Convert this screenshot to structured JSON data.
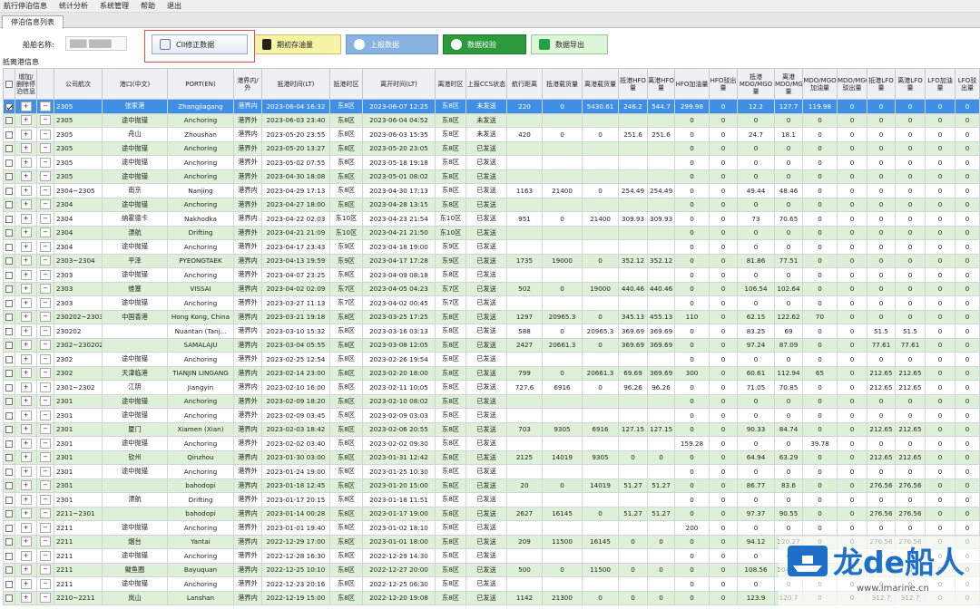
{
  "menu": [
    "航行停泊信息",
    "统计分析",
    "系统管理",
    "帮助",
    "退出"
  ],
  "tab": "停泊信息列表",
  "ship": {
    "label": "船舶名称:",
    "value": "███ ████"
  },
  "buttons": {
    "cii": "CII修正数据",
    "fuel": "期初存油量",
    "report": "上报数据",
    "validate": "数据校验",
    "export": "数据导出"
  },
  "section_title": "抵离港信息",
  "columns": [
    "",
    "增加/删除停泊信息",
    "",
    "公司航次",
    "港口(中文)",
    "PORT(EN)",
    "港界内/外",
    "抵港时间(LT)",
    "抵港时区",
    "离开时间(LT)",
    "离港时区",
    "上报CCS状态",
    "航行距离",
    "抵港载货量",
    "离港载货量",
    "抵港HFO量",
    "离港HFO量",
    "HFO加油量",
    "HFO驳出量",
    "抵港MDO/MGO量",
    "离港MDO/MGO量",
    "MDO/MGO加油量",
    "MDO/MGO驳出量",
    "抵港LFO量",
    "离港LFO量",
    "LFO加油量",
    "LFO驳出量"
  ],
  "rows": [
    [
      "1",
      "2305",
      "张家港",
      "Zhangjiagang",
      "港界内",
      "2023-06-04 16:32",
      "东8区",
      "2023-06-07 12:25",
      "东8区",
      "未发送",
      "220",
      "0",
      "5430.61",
      "246.2",
      "544.7",
      "299.98",
      "0",
      "12.2",
      "127.7",
      "119.98",
      "0",
      "0",
      "0",
      "0",
      "0"
    ],
    [
      "0",
      "2305",
      "途中抛锚",
      "Anchoring",
      "港界外",
      "2023-06-03 23:40",
      "东8区",
      "2023-06-04 04:52",
      "东8区",
      "未发送",
      "",
      "",
      "",
      "",
      "",
      "0",
      "0",
      "0",
      "0",
      "0",
      "0",
      "0",
      "0",
      "0",
      "0"
    ],
    [
      "0",
      "2305",
      "舟山",
      "Zhoushan",
      "港界内",
      "2023-05-20 23:55",
      "东8区",
      "2023-06-03 15:35",
      "东8区",
      "未发送",
      "420",
      "0",
      "0",
      "251.6",
      "251.6",
      "0",
      "0",
      "24.7",
      "18.1",
      "0",
      "0",
      "0",
      "0",
      "0",
      "0"
    ],
    [
      "0",
      "2305",
      "途中抛锚",
      "Anchoring",
      "港界外",
      "2023-05-20 13:27",
      "东8区",
      "2023-05-20 23:05",
      "东8区",
      "已发送",
      "",
      "",
      "",
      "",
      "",
      "0",
      "0",
      "0",
      "0",
      "0",
      "0",
      "0",
      "0",
      "0",
      "0"
    ],
    [
      "0",
      "2305",
      "途中抛锚",
      "Anchoring",
      "港界外",
      "2023-05-02 07:55",
      "东8区",
      "2023-05-18 19:18",
      "东8区",
      "已发送",
      "",
      "",
      "",
      "",
      "",
      "0",
      "0",
      "0",
      "0",
      "0",
      "0",
      "0",
      "0",
      "0",
      "0"
    ],
    [
      "0",
      "2305",
      "途中抛锚",
      "Anchoring",
      "港界外",
      "2023-04-30 18:08",
      "东8区",
      "2023-05-01 08:02",
      "东8区",
      "已发送",
      "",
      "",
      "",
      "",
      "",
      "0",
      "0",
      "0",
      "0",
      "0",
      "0",
      "0",
      "0",
      "0",
      "0"
    ],
    [
      "0",
      "2304~2305",
      "南京",
      "Nanjing",
      "港界内",
      "2023-04-29 17:13",
      "东8区",
      "2023-04-30 17:13",
      "东8区",
      "已发送",
      "1163",
      "21400",
      "0",
      "254.49",
      "254.49",
      "0",
      "0",
      "49.44",
      "48.46",
      "0",
      "0",
      "0",
      "0",
      "0",
      "0"
    ],
    [
      "0",
      "2304",
      "途中抛锚",
      "Anchoring",
      "港界外",
      "2023-04-27 18:00",
      "东8区",
      "2023-04-28 13:15",
      "东8区",
      "已发送",
      "",
      "",
      "",
      "",
      "",
      "0",
      "0",
      "0",
      "0",
      "0",
      "0",
      "0",
      "0",
      "0",
      "0"
    ],
    [
      "0",
      "2304",
      "纳霍德卡",
      "Nakhodka",
      "港界内",
      "2023-04-22 02:03",
      "东10区",
      "2023-04-23 21:54",
      "东10区",
      "已发送",
      "951",
      "0",
      "21400",
      "309.93",
      "309.93",
      "0",
      "0",
      "73",
      "70.65",
      "0",
      "0",
      "0",
      "0",
      "0",
      "0"
    ],
    [
      "0",
      "2304",
      "漂航",
      "Drifting",
      "港界外",
      "2023-04-21 21:09",
      "东10区",
      "2023-04-21 21:50",
      "东10区",
      "已发送",
      "",
      "",
      "",
      "",
      "",
      "0",
      "0",
      "0",
      "0",
      "0",
      "0",
      "0",
      "0",
      "0",
      "0"
    ],
    [
      "0",
      "2304",
      "途中抛锚",
      "Anchoring",
      "港界外",
      "2023-04-17 23:43",
      "东9区",
      "2023-04-18 19:00",
      "东9区",
      "已发送",
      "",
      "",
      "",
      "",
      "",
      "0",
      "0",
      "0",
      "0",
      "0",
      "0",
      "0",
      "0",
      "0",
      "0"
    ],
    [
      "0",
      "2303~2304",
      "平泽",
      "PYEONGTAEK",
      "港界内",
      "2023-04-13 19:59",
      "东9区",
      "2023-04-17 17:28",
      "东9区",
      "已发送",
      "1735",
      "19000",
      "0",
      "352.12",
      "352.12",
      "0",
      "0",
      "81.86",
      "77.51",
      "0",
      "0",
      "0",
      "0",
      "0",
      "0"
    ],
    [
      "0",
      "2303",
      "途中抛锚",
      "Anchoring",
      "港界外",
      "2023-04-07 23:25",
      "东8区",
      "2023-04-09 08:18",
      "东8区",
      "已发送",
      "",
      "",
      "",
      "",
      "",
      "0",
      "0",
      "0",
      "0",
      "0",
      "0",
      "0",
      "0",
      "0",
      "0"
    ],
    [
      "0",
      "2303",
      "维塞",
      "VISSAI",
      "港界内",
      "2023-04-02 02:09",
      "东7区",
      "2023-04-05 04:23",
      "东7区",
      "已发送",
      "502",
      "0",
      "19000",
      "440.46",
      "440.46",
      "0",
      "0",
      "106.54",
      "102.64",
      "0",
      "0",
      "0",
      "0",
      "0",
      "0"
    ],
    [
      "0",
      "2303",
      "途中抛锚",
      "Anchoring",
      "港界外",
      "2023-03-27 11:13",
      "东7区",
      "2023-04-02 00:45",
      "东7区",
      "已发送",
      "",
      "",
      "",
      "",
      "",
      "0",
      "0",
      "0",
      "0",
      "0",
      "0",
      "0",
      "0",
      "0",
      "0"
    ],
    [
      "0",
      "230202~2303",
      "中国香港",
      "Hong Kong, China",
      "港界内",
      "2023-03-21 19:18",
      "东8区",
      "2023-03-25 17:25",
      "东8区",
      "已发送",
      "1297",
      "20965.3",
      "0",
      "345.13",
      "455.13",
      "110",
      "0",
      "62.15",
      "122.62",
      "70",
      "0",
      "0",
      "0",
      "0",
      "0"
    ],
    [
      "0",
      "230202",
      "",
      "Nuantan (Tanj...",
      "港界内",
      "2023-03-10 15:32",
      "东8区",
      "2023-03-16 03:13",
      "东8区",
      "已发送",
      "588",
      "0",
      "20965.3",
      "369.69",
      "369.69",
      "0",
      "0",
      "83.25",
      "69",
      "0",
      "0",
      "51.5",
      "51.5",
      "0",
      "0"
    ],
    [
      "0",
      "2302~230202",
      "",
      "SAMALAJU",
      "港界内",
      "2023-03-04 05:55",
      "东8区",
      "2023-03-08 12:05",
      "东8区",
      "已发送",
      "2427",
      "20661.3",
      "0",
      "369.69",
      "369.69",
      "0",
      "0",
      "97.24",
      "87.09",
      "0",
      "0",
      "77.61",
      "77.61",
      "0",
      "0"
    ],
    [
      "0",
      "2302",
      "途中抛锚",
      "Anchoring",
      "港界外",
      "2023-02-25 12:54",
      "东8区",
      "2023-02-26 19:54",
      "东8区",
      "已发送",
      "",
      "",
      "",
      "",
      "",
      "0",
      "0",
      "0",
      "0",
      "0",
      "0",
      "0",
      "0",
      "0",
      "0"
    ],
    [
      "0",
      "2302",
      "天津临港",
      "TIANJIN LINGANG",
      "港界内",
      "2023-02-14 23:00",
      "东8区",
      "2023-02-20 18:00",
      "东8区",
      "已发送",
      "799",
      "0",
      "20661.3",
      "69.69",
      "369.69",
      "300",
      "0",
      "60.61",
      "112.94",
      "65",
      "0",
      "212.65",
      "212.65",
      "0",
      "0"
    ],
    [
      "0",
      "2301~2302",
      "江阴",
      "Jiangyin",
      "港界内",
      "2023-02-10 16:00",
      "东8区",
      "2023-02-11 10:05",
      "东8区",
      "已发送",
      "727.6",
      "6916",
      "0",
      "96.26",
      "96.26",
      "0",
      "0",
      "71.05",
      "70.85",
      "0",
      "0",
      "212.65",
      "212.65",
      "0",
      "0"
    ],
    [
      "0",
      "2301",
      "途中抛锚",
      "Anchoring",
      "港界外",
      "2023-02-09 18:20",
      "东8区",
      "2023-02-10 08:02",
      "东8区",
      "已发送",
      "",
      "",
      "",
      "",
      "",
      "0",
      "0",
      "0",
      "0",
      "0",
      "0",
      "0",
      "0",
      "0",
      "0"
    ],
    [
      "0",
      "2301",
      "途中抛锚",
      "Anchoring",
      "港界外",
      "2023-02-09 03:45",
      "东8区",
      "2023-02-09 03:03",
      "东8区",
      "已发送",
      "",
      "",
      "",
      "",
      "",
      "0",
      "0",
      "0",
      "0",
      "0",
      "0",
      "0",
      "0",
      "0",
      "0"
    ],
    [
      "0",
      "2301",
      "厦门",
      "Xiamen (Xian)",
      "港界内",
      "2023-02-03 18:42",
      "东8区",
      "2023-02-06 20:55",
      "东8区",
      "已发送",
      "703",
      "9305",
      "6916",
      "127.15",
      "127.15",
      "0",
      "0",
      "90.33",
      "84.74",
      "0",
      "0",
      "212.65",
      "212.65",
      "0",
      "0"
    ],
    [
      "0",
      "2301",
      "途中抛锚",
      "Anchoring",
      "港界外",
      "2023-02-02 03:40",
      "东8区",
      "2023-02-02 09:30",
      "东8区",
      "已发送",
      "",
      "",
      "",
      "",
      "",
      "159.28",
      "0",
      "0",
      "0",
      "39.78",
      "0",
      "0",
      "0",
      "0",
      "0"
    ],
    [
      "0",
      "2301",
      "钦州",
      "Qinzhou",
      "港界内",
      "2023-01-30 03:00",
      "东8区",
      "2023-01-31 12:42",
      "东8区",
      "已发送",
      "2125",
      "14019",
      "9305",
      "0",
      "0",
      "0",
      "0",
      "64.94",
      "63.29",
      "0",
      "0",
      "212.65",
      "212.65",
      "0",
      "0"
    ],
    [
      "0",
      "2301",
      "途中抛锚",
      "Anchoring",
      "港界外",
      "2023-01-24 19:00",
      "东8区",
      "2023-01-25 10:30",
      "东8区",
      "已发送",
      "",
      "",
      "",
      "",
      "",
      "0",
      "0",
      "0",
      "0",
      "0",
      "0",
      "0",
      "0",
      "0",
      "0"
    ],
    [
      "0",
      "2301",
      "",
      "bahodopi",
      "港界内",
      "2023-01-18 12:45",
      "东8区",
      "2023-01-20 15:00",
      "东8区",
      "已发送",
      "20",
      "0",
      "14019",
      "51.27",
      "51.27",
      "0",
      "0",
      "86.77",
      "83.6",
      "0",
      "0",
      "276.56",
      "276.56",
      "0",
      "0"
    ],
    [
      "0",
      "2301",
      "漂航",
      "Drifting",
      "港界外",
      "2023-01-17 20:15",
      "东8区",
      "2023-01-18 11:51",
      "东8区",
      "已发送",
      "",
      "",
      "",
      "",
      "",
      "0",
      "0",
      "0",
      "0",
      "0",
      "0",
      "0",
      "0",
      "0",
      "0"
    ],
    [
      "0",
      "2211~2301",
      "",
      "bahodopi",
      "港界内",
      "2023-01-14 00:28",
      "东8区",
      "2023-01-17 19:00",
      "东8区",
      "已发送",
      "2627",
      "16145",
      "0",
      "51.27",
      "51.27",
      "0",
      "0",
      "97.37",
      "90.55",
      "0",
      "0",
      "276.56",
      "276.56",
      "0",
      "0"
    ],
    [
      "0",
      "2211",
      "途中抛锚",
      "Anchoring",
      "港界外",
      "2023-01-01 19:40",
      "东8区",
      "2023-01-02 18:10",
      "东8区",
      "已发送",
      "",
      "",
      "",
      "",
      "",
      "200",
      "0",
      "0",
      "0",
      "0",
      "0",
      "0",
      "0",
      "0",
      "0"
    ],
    [
      "0",
      "2211",
      "烟台",
      "Yantai",
      "港界内",
      "2022-12-29 17:00",
      "东8区",
      "2023-01-01 18:00",
      "东8区",
      "已发送",
      "209",
      "11500",
      "16145",
      "0",
      "0",
      "0",
      "0",
      "94.12",
      "120.27",
      "0",
      "0",
      "276.56",
      "276.56",
      "0",
      "0"
    ],
    [
      "0",
      "2211",
      "途中抛锚",
      "Anchoring",
      "港界外",
      "2022-12-28 16:30",
      "东8区",
      "2022-12-29 14:30",
      "东8区",
      "已发送",
      "",
      "",
      "",
      "",
      "",
      "0",
      "0",
      "0",
      "0",
      "0",
      "0",
      "0",
      "0",
      "0",
      "0"
    ],
    [
      "0",
      "2211",
      "鲅鱼圈",
      "Bayuquan",
      "港界内",
      "2022-12-25 10:10",
      "东8区",
      "2022-12-27 20:00",
      "东8区",
      "已发送",
      "500",
      "0",
      "11500",
      "0",
      "0",
      "0",
      "0",
      "108.56",
      "104.18",
      "0",
      "0",
      "0",
      "0",
      "0",
      "0"
    ],
    [
      "0",
      "2211",
      "途中抛锚",
      "Anchoring",
      "港界外",
      "2022-12-23 20:16",
      "东8区",
      "2022-12-25 06:30",
      "东8区",
      "已发送",
      "",
      "",
      "",
      "",
      "",
      "0",
      "0",
      "0",
      "0",
      "0",
      "0",
      "0",
      "0",
      "0",
      "0"
    ],
    [
      "0",
      "2210~2211",
      "岚山",
      "Lanshan",
      "港界内",
      "2022-12-19 15:00",
      "东8区",
      "2022-12-20 19:08",
      "东8区",
      "已发送",
      "1142",
      "21300",
      "0",
      "0",
      "0",
      "0",
      "0",
      "123.9",
      "120.7",
      "0",
      "0",
      "312.7",
      "312.7",
      "0",
      "0"
    ]
  ],
  "watermark": {
    "brand": "龙de船人",
    "url": "www.imarine.cn"
  }
}
